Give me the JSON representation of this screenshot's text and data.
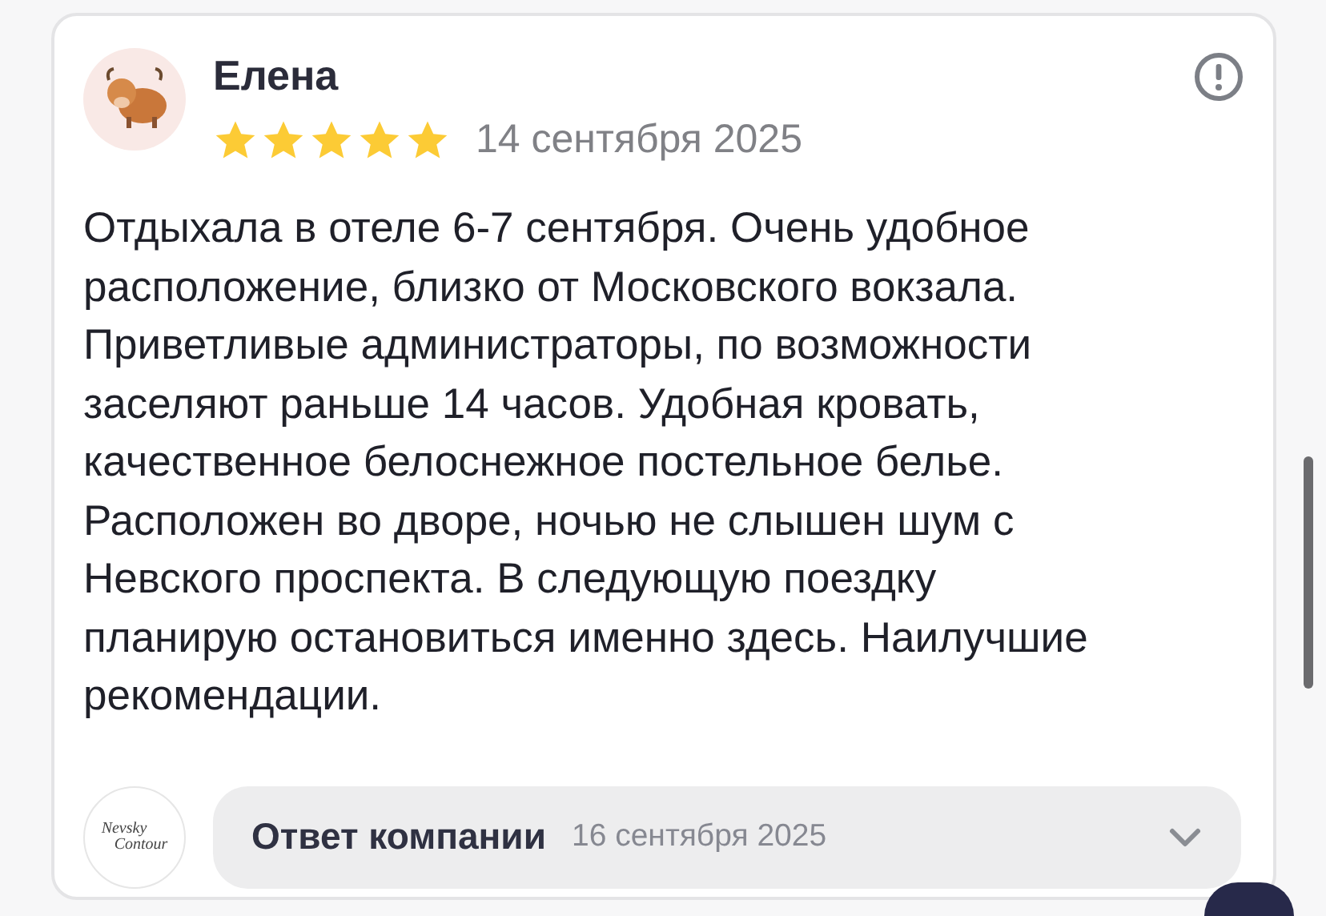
{
  "review": {
    "author": "Елена",
    "stars": 5,
    "date": "14 сентября 2025",
    "text": "Отдыхала в отеле 6-7 сентября. Очень удобное расположение, близко от Московского вокзала. Приветливые администраторы, по возможности заселяют раньше 14 часов. Удобная кровать, качественное белоснежное постельное белье. Расположен во дворе, ночью не слышен шум с Невского проспекта. В следующую поездку планирую остановиться именно здесь. Наилучшие рекомендации."
  },
  "reply": {
    "logo_lines": [
      "Nevsky",
      "Contour"
    ],
    "label": "Ответ компании",
    "date": "16 сентября 2025",
    "expanded": false
  }
}
